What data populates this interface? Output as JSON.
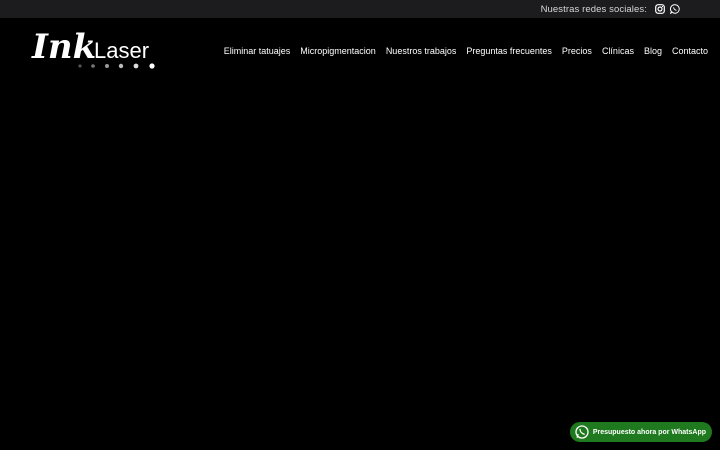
{
  "topbar": {
    "social_label": "Nuestras redes sociales:",
    "icons": [
      "instagram-icon",
      "whatsapp-icon"
    ]
  },
  "logo": {
    "brand_ink": "Ink",
    "brand_laser": "Laser"
  },
  "nav": {
    "items": [
      {
        "label": "Eliminar tatuajes"
      },
      {
        "label": "Micropigmentacion"
      },
      {
        "label": "Nuestros trabajos"
      },
      {
        "label": "Preguntas frecuentes"
      },
      {
        "label": "Precios"
      },
      {
        "label": "Clínicas"
      },
      {
        "label": "Blog"
      },
      {
        "label": "Contacto"
      }
    ]
  },
  "whatsapp_button": {
    "label": "Presupuesto ahora por WhatsApp",
    "color": "#1f7a1f"
  },
  "colors": {
    "topbar_bg": "#1c1c1e",
    "page_bg": "#000000",
    "text": "#ffffff"
  }
}
